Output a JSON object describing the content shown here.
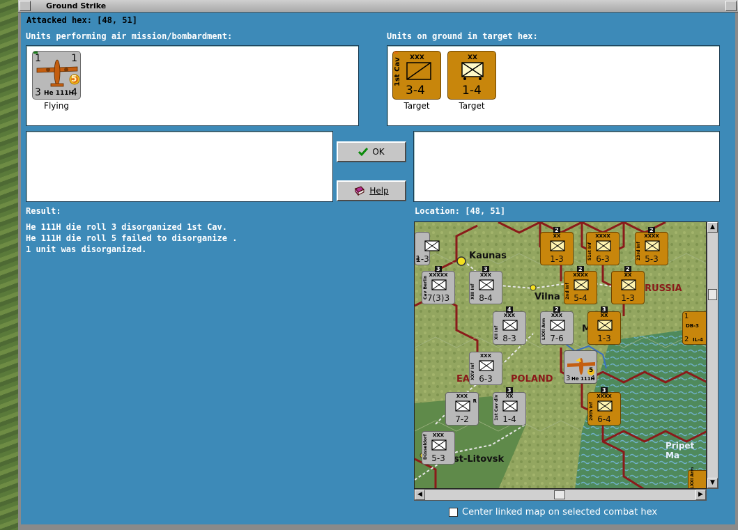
{
  "window": {
    "title": "Ground Strike"
  },
  "attacked_hex": {
    "label": "Attacked hex:",
    "value": "[48, 51]"
  },
  "air_units": {
    "header": "Units performing air mission/bombardment:",
    "items": [
      {
        "name": "He 111H",
        "top_left": "1",
        "top_right": "1",
        "bottom_left": "3",
        "bottom_right": "4",
        "badge": "5",
        "status": "Flying"
      }
    ]
  },
  "ground_units": {
    "header": "Units on ground in target hex:",
    "items": [
      {
        "side_label": "1st Cav",
        "size": "XXX",
        "strength": "3-4",
        "status": "Target"
      },
      {
        "size": "XX",
        "strength": "1-4",
        "status": "Target"
      }
    ]
  },
  "buttons": {
    "ok": "OK",
    "help": "Help"
  },
  "result": {
    "label": "Result:",
    "lines": [
      "He 111H die roll 3 disorganized 1st Cav.",
      "He 111H die roll 5 failed to disorganize .",
      "1 unit was disorganized."
    ]
  },
  "location": {
    "label": "Location:",
    "value": "[48, 51]"
  },
  "map": {
    "place_labels": [
      "Kaunas",
      "Vilna",
      "RUSSIA",
      "EA",
      "POLAND",
      "st-Litovsk",
      "Pripet Ma",
      "M"
    ],
    "counters": [
      {
        "id": "c1",
        "strength": "1-3",
        "color": "orange",
        "stack": "2",
        "size": "XX"
      },
      {
        "id": "c2",
        "strength": "6-3",
        "color": "orange",
        "size": "XXXX",
        "side": "51st Inf"
      },
      {
        "id": "c3",
        "strength": "5-3",
        "color": "orange",
        "stack": "2",
        "size": "XXXX",
        "side": "23rd Inf"
      },
      {
        "id": "c4",
        "strength": "7(3)3",
        "color": "grey",
        "stack": "3",
        "size": "XXXXX",
        "side": "Cav Berlin"
      },
      {
        "id": "c5",
        "strength": "8-4",
        "color": "grey",
        "stack": "3",
        "size": "XXX",
        "side": "XIII Inf"
      },
      {
        "id": "c6",
        "strength": "5-4",
        "color": "orange",
        "stack": "2",
        "size": "XXXX",
        "side": "2nd Inf"
      },
      {
        "id": "c7",
        "strength": "1-3",
        "color": "orange",
        "stack": "2",
        "size": "XX"
      },
      {
        "id": "c8",
        "strength": "8-3",
        "color": "grey",
        "stack": "4",
        "size": "XXX",
        "side": "XII Inf"
      },
      {
        "id": "c9",
        "strength": "7-6",
        "color": "grey",
        "stack": "2",
        "size": "XXX",
        "side": "LXXI Arm"
      },
      {
        "id": "c10",
        "strength": "1-3",
        "color": "orange",
        "stack": "3",
        "size": "XX"
      },
      {
        "id": "c11",
        "strength": "6-3",
        "color": "grey",
        "size": "XXX",
        "side": "XXV Inf"
      },
      {
        "id": "c12",
        "strength": "7-2",
        "color": "grey",
        "size": "XXX",
        "badge": "R"
      },
      {
        "id": "c13",
        "strength": "1-4",
        "color": "grey",
        "stack": "3",
        "size": "XX",
        "side": "1st Cav div"
      },
      {
        "id": "c14",
        "strength": "6-4",
        "color": "orange",
        "stack": "3",
        "size": "XXXX",
        "side": "20th Inf"
      },
      {
        "id": "c15",
        "strength": "5-3",
        "color": "grey",
        "size": "XXX",
        "side": "Düsseldorf"
      },
      {
        "id": "c16",
        "strength": "1-3",
        "color": "grey",
        "side": "R"
      }
    ],
    "air_counter": {
      "name": "He 111H",
      "left": "3",
      "right": "4",
      "badge": "5"
    },
    "edge_air": {
      "name": "DB-3",
      "code": "IL-4",
      "top": "1",
      "bottom": "2"
    },
    "edge_counter_side": "LXXI Arm"
  },
  "footer": {
    "center_linked_label": "Center linked map on selected combat hex"
  },
  "colors": {
    "background": "#3d8ab8",
    "orange_counter": "#c8860c",
    "grey_counter": "#b9b9b9",
    "hex_border": "#8a1a1a"
  }
}
